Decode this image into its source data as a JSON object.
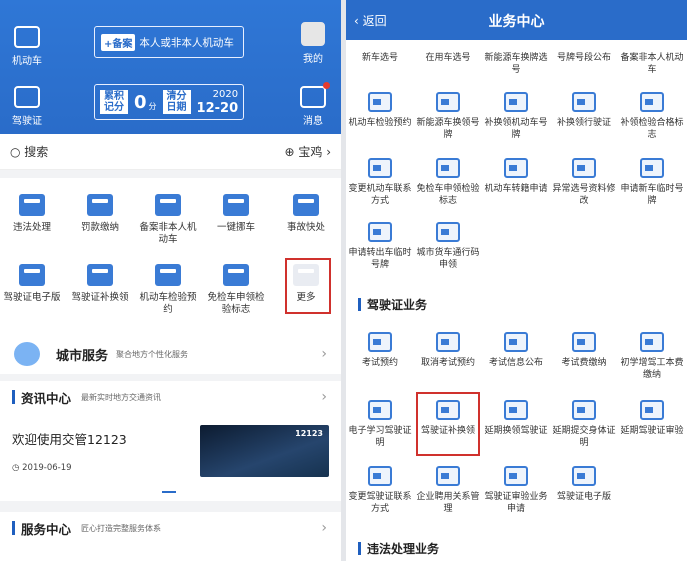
{
  "left": {
    "header": {
      "vehicle_label": "机动车",
      "mine_label": "我的",
      "license_label": "驾驶证",
      "message_label": "消息",
      "plate_badge": "+备案",
      "plate_text": "本人或非本人机动车",
      "score_label": "累积记分",
      "score_value": "0",
      "score_unit": "分",
      "clear_label": "清分日期",
      "clear_year": "2020",
      "clear_date": "12-20"
    },
    "search": {
      "label": "搜索",
      "location": "宝鸡"
    },
    "grid": [
      "违法处理",
      "罚款缴纳",
      "备案非本人机动车",
      "一键挪车",
      "事故快处",
      "驾驶证电子版",
      "驾驶证补换领",
      "机动车检验预约",
      "免检车申领检验标志",
      "更多"
    ],
    "city": {
      "title": "城市服务",
      "subtitle": "聚合地方个性化服务"
    },
    "news": {
      "title": "资讯中心",
      "subtitle": "最新实时地方交通资讯",
      "headline": "欢迎使用交管12123",
      "date": "2019-06-19",
      "thumb_text": "12123"
    },
    "service": {
      "title": "服务中心",
      "subtitle": "匠心打造完整服务体系"
    }
  },
  "right": {
    "back": "返回",
    "title": "业务中心",
    "row0": [
      "新车选号",
      "在用车选号",
      "新能源车换牌选号",
      "号牌号段公布",
      "备案非本人机动车"
    ],
    "row1": [
      "机动车检验预约",
      "新能源车换领号牌",
      "补换领机动车号牌",
      "补换领行驶证",
      "补领检验合格标志"
    ],
    "row2": [
      "变更机动车联系方式",
      "免检车申领检验标志",
      "机动车转籍申请",
      "异常选号资料修改",
      "申请新车临时号牌"
    ],
    "row3": [
      "申请转出车临时号牌",
      "城市货车通行码申领"
    ],
    "license_section": "驾驶证业务",
    "row4": [
      "考试预约",
      "取消考试预约",
      "考试信息公布",
      "考试费缴纳",
      "初学增驾工本费缴纳"
    ],
    "row5": [
      "电子学习驾驶证明",
      "驾驶证补换领",
      "延期换领驾驶证",
      "延期提交身体证明",
      "延期驾驶证审验"
    ],
    "row6": [
      "变更驾驶证联系方式",
      "企业聘用关系管理",
      "驾驶证审验业务申请",
      "驾驶证电子版"
    ],
    "violation_section": "违法处理业务"
  }
}
